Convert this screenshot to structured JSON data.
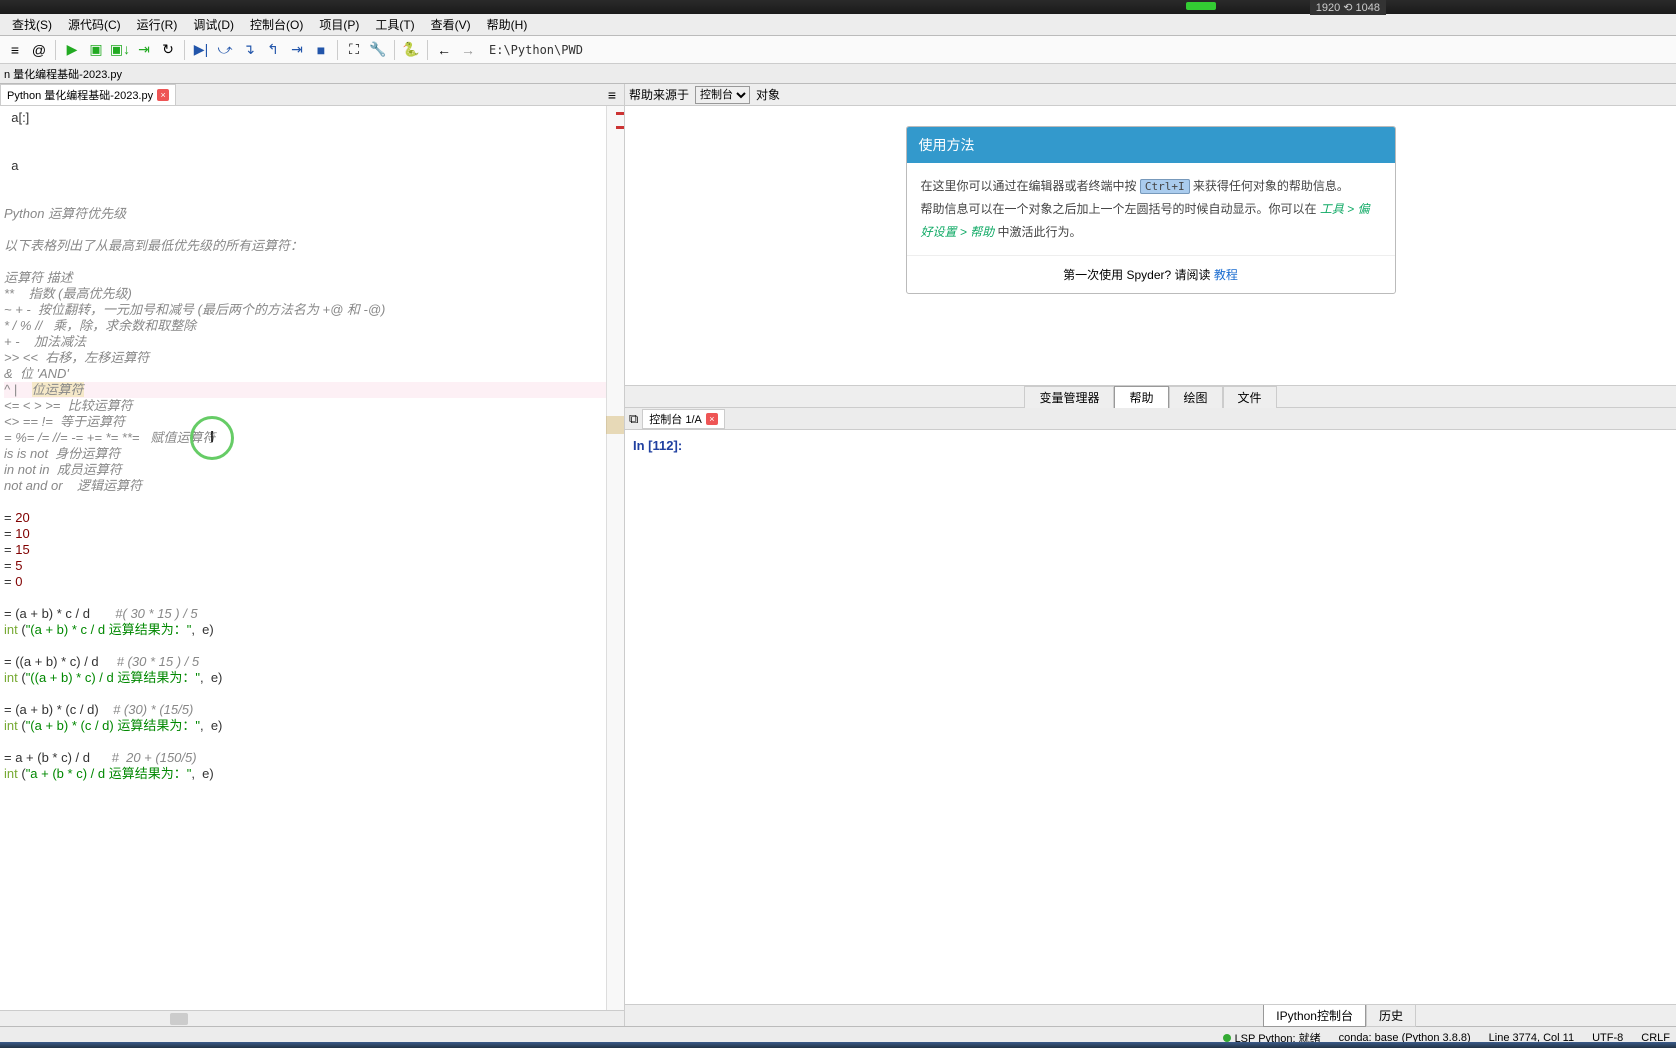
{
  "titlebar": {
    "res": "1920 ⟲ 1048"
  },
  "menu": [
    "查找(S)",
    "源代码(C)",
    "运行(R)",
    "调试(D)",
    "控制台(O)",
    "项目(P)",
    "工具(T)",
    "查看(V)",
    "帮助(H)"
  ],
  "toolbar_path": "E:\\Python\\PWD",
  "file_tab_title": "n 量化编程基础-2023.py",
  "editor_tab": "Python 量化编程基础-2023.py",
  "cursor_char": "I",
  "code": {
    "l1": "  a[:]",
    "l2": "",
    "l3": "",
    "l4": "  a",
    "l5": "",
    "l6": "",
    "l7": "Python 运算符优先级",
    "l8": "",
    "l9": "以下表格列出了从最高到最低优先级的所有运算符：",
    "l10": "",
    "l11": "运算符 描述",
    "l12": "**    指数 (最高优先级)",
    "l13": "~ + -  按位翻转，一元加号和减号 (最后两个的方法名为 +@ 和 -@)",
    "l14": "* / % //   乘，除，求余数和取整除",
    "l15": "+ -    加法减法",
    "l16": ">> <<  右移，左移运算符",
    "l17": "&  位 'AND'",
    "l18": "^ |    位运算符",
    "l19": "<= < > >=  比较运算符",
    "l20": "<> == !=  等于运算符",
    "l21": "= %= /= //= -= += *= **=   赋值运算符",
    "l22": "is is not  身份运算符",
    "l23": "in not in  成员运算符",
    "l24": "not and or    逻辑运算符",
    "l25": "",
    "l26a": "= ",
    "l26b": "20",
    "l27a": "= ",
    "l27b": "10",
    "l28a": "= ",
    "l28b": "15",
    "l29a": "= ",
    "l29b": "5",
    "l30a": "= ",
    "l30b": "0",
    "l31": "",
    "l32a": "= (a + b) * c / d       ",
    "l32b": "#( 30 * 15 ) / 5",
    "l33a": "int",
    "l33b": " (",
    "l33c": "\"(a + b) * c / d 运算结果为：\"",
    "l33d": ",  e)",
    "l34": "",
    "l35a": "= ((a + b) * c) / d     ",
    "l35b": "# (30 * 15 ) / 5",
    "l36a": "int",
    "l36b": " (",
    "l36c": "\"((a + b) * c) / d 运算结果为：\"",
    "l36d": ",  e)",
    "l37": "",
    "l38a": "= (a + b) * (c / d)    ",
    "l38b": "# (30) * (15/5)",
    "l39a": "int",
    "l39b": " (",
    "l39c": "\"(a + b) * (c / d) 运算结果为：\"",
    "l39d": ",  e)",
    "l40": "",
    "l41a": "= a + (b * c) / d      ",
    "l41b": "#  20 + (150/5)",
    "l42a": "int",
    "l42b": " (",
    "l42c": "\"a + (b * c) / d 运算结果为：\"",
    "l42d": ",  e)"
  },
  "help": {
    "source_label": "帮助来源于",
    "source_value": "控制台",
    "object_label": "对象",
    "card_title": "使用方法",
    "p1_pre": "在这里你可以通过在编辑器或者终端中按 ",
    "p1_kbd": "Ctrl+I",
    "p1_post": " 来获得任何对象的帮助信息。",
    "p2_pre": "帮助信息可以在一个对象之后加上一个左圆括号的时候自动显示。你可以在 ",
    "p2_i": "工具 > 偏好设置 > 帮助 ",
    "p2_post": "中激活此行为。",
    "footer_text": "第一次使用 Spyder? 请阅读 ",
    "footer_link": "教程"
  },
  "right_tabs": [
    "变量管理器",
    "帮助",
    "绘图",
    "文件"
  ],
  "console_tab": "控制台 1/A",
  "console_in": "In [",
  "console_num": "112",
  "console_close": "]:",
  "bottom_tabs": [
    "IPython控制台",
    "历史"
  ],
  "status": {
    "lsp": "LSP Python: 就绪",
    "conda": "conda: base (Python 3.8.8)",
    "cursor": "Line 3774, Col 11",
    "encoding": "UTF-8",
    "eol": "CRLF"
  }
}
